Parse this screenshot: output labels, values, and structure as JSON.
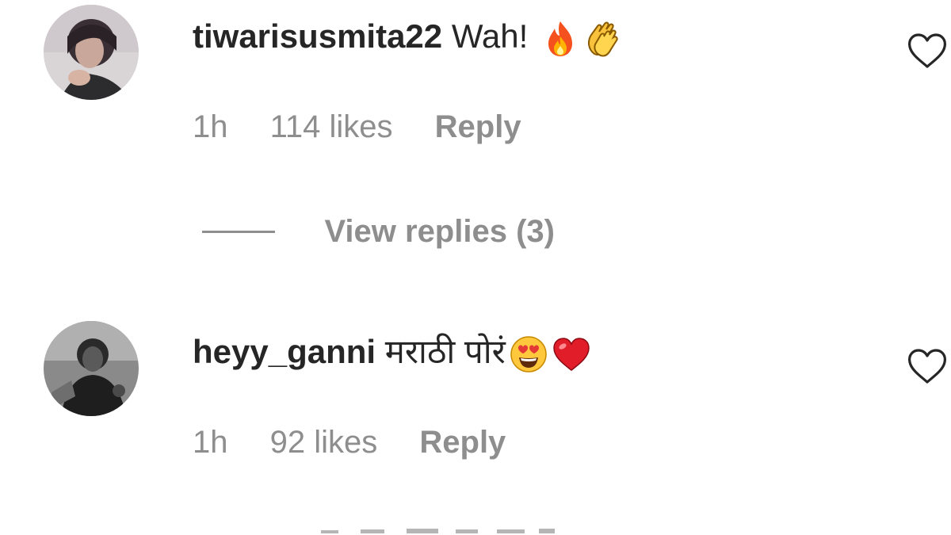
{
  "comments": [
    {
      "username": "tiwarisusmita22",
      "text": "Wah!",
      "emojis": [
        "fire-emoji",
        "clapping-hands-emoji"
      ],
      "time": "1h",
      "likes": "114 likes",
      "reply_label": "Reply",
      "view_replies": "View replies (3)"
    },
    {
      "username": "heyy_ganni",
      "text": "मराठी पोरं",
      "emojis": [
        "heart-eyes-emoji",
        "red-heart-emoji"
      ],
      "time": "1h",
      "likes": "92 likes",
      "reply_label": "Reply"
    }
  ],
  "icons": {
    "like": "heart-outline-icon"
  },
  "colors": {
    "text": "#262626",
    "secondary": "#8e8e8e",
    "background": "#ffffff"
  }
}
